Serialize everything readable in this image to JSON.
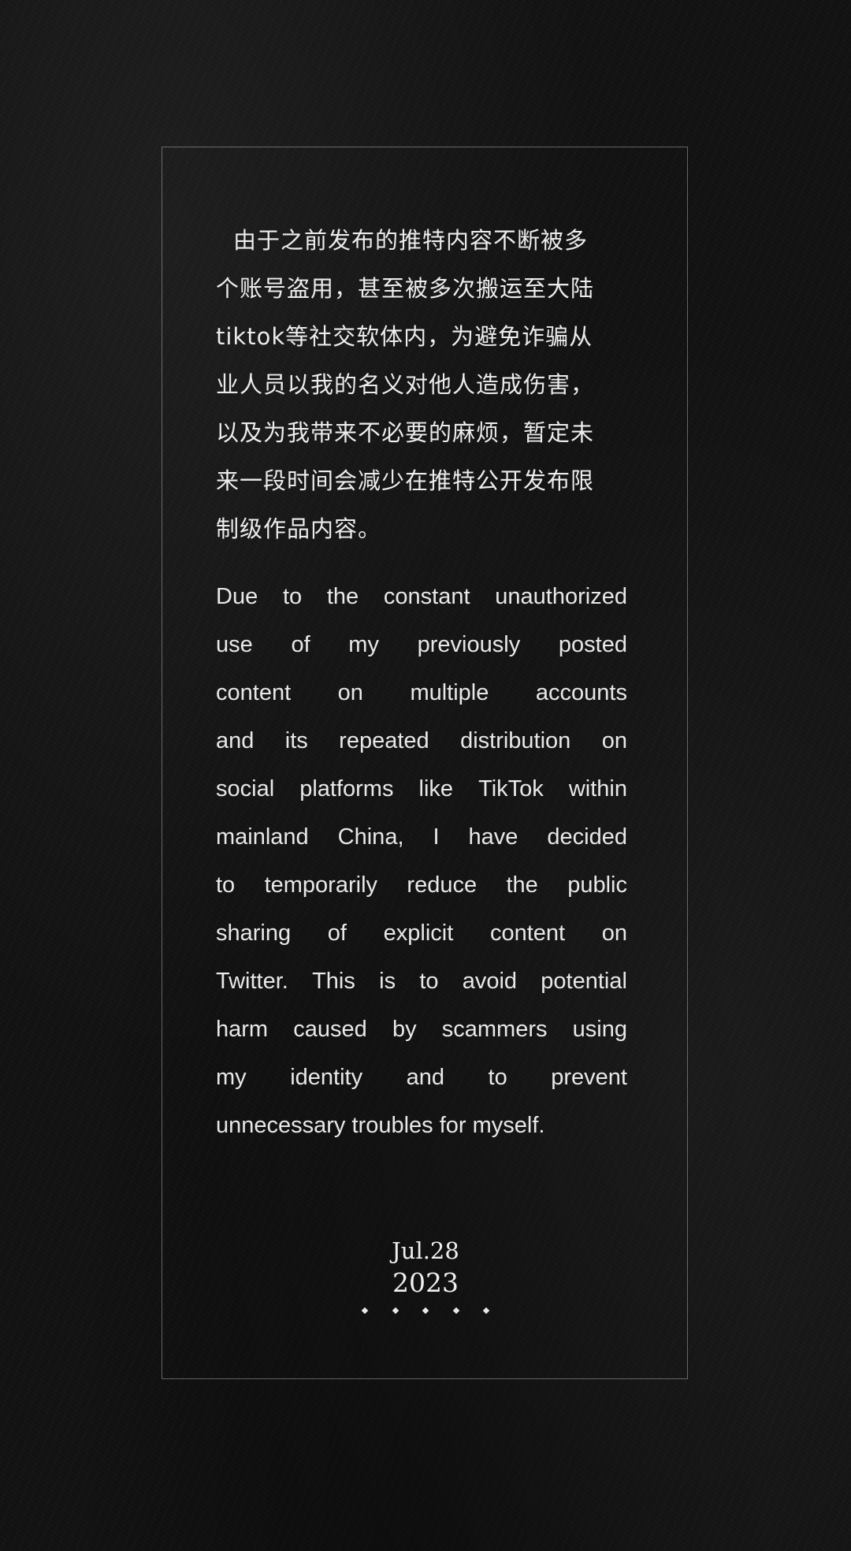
{
  "chinese": {
    "lines": [
      "由于之前发布的推特内容不断被多",
      "个账号盗用，甚至被多次搬运至大陆",
      "tiktok等社交软体内，为避免诈骗从",
      "业人员以我的名义对他人造成伤害，",
      "以及为我带来不必要的麻烦，暂定未",
      "来一段时间会减少在推特公开发布限",
      "制级作品内容。"
    ]
  },
  "english": {
    "lines": [
      [
        "Due",
        "to",
        "the",
        "constant",
        "unauthorized"
      ],
      [
        "use",
        "of",
        "my",
        "previously",
        "posted"
      ],
      [
        "content",
        "on",
        "multiple",
        "accounts"
      ],
      [
        "and",
        "its",
        "repeated",
        "distribution",
        "on"
      ],
      [
        "social",
        "platforms",
        "like",
        "TikTok",
        "within"
      ],
      [
        "mainland",
        "China,",
        "I",
        "have",
        "decided"
      ],
      [
        "to",
        "temporarily",
        "reduce",
        "the",
        "public"
      ],
      [
        "sharing",
        "of",
        "explicit",
        "content",
        "on"
      ],
      [
        "Twitter.",
        "This",
        "is",
        "to",
        "avoid",
        "potential"
      ],
      [
        "harm",
        "caused",
        "by",
        "scammers",
        "using"
      ],
      [
        "my",
        "identity",
        "and",
        "to",
        "prevent"
      ],
      [
        "unnecessary troubles for myself."
      ]
    ]
  },
  "date": {
    "month_day": "Jul.28",
    "year": "2023"
  },
  "ornament": {
    "dot_count": 5
  }
}
